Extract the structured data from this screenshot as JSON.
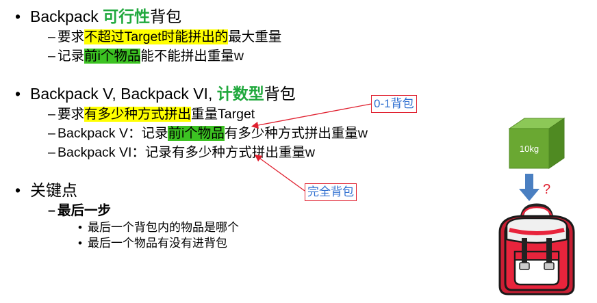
{
  "sections": [
    {
      "heading": {
        "bullet": "•",
        "pre": "Backpack ",
        "green": "可行性",
        "post": "背包"
      },
      "items": [
        {
          "dash": "–",
          "p1": "要求",
          "hl": "不超过Target时能拼出的",
          "p2": "最大重量"
        },
        {
          "dash": "–",
          "p1": "记录",
          "hl": "前i个物品",
          "p2": "能不能拼出重量w"
        }
      ]
    },
    {
      "heading": {
        "bullet": "•",
        "pre": "Backpack V, Backpack VI, ",
        "green": "计数型",
        "post": "背包"
      },
      "items": [
        {
          "dash": "–",
          "p1": "要求",
          "hl": "有多少种方式拼出",
          "p2": "重量Target"
        },
        {
          "dash": "–",
          "p1": "Backpack V：记录",
          "hl": "前i个物品",
          "p2": "有多少种方式拼出重量w"
        },
        {
          "dash": "–",
          "p1": "Backpack VI：记录有多少种方式拼出重量w"
        }
      ]
    },
    {
      "heading": {
        "bullet": "•",
        "text": "关键点"
      },
      "sub": {
        "dash": "–",
        "text": "最后一步"
      },
      "points": [
        {
          "bullet": "•",
          "text": "最后一个背包内的物品是哪个"
        },
        {
          "bullet": "•",
          "text": "最后一个物品有没有进背包"
        }
      ]
    }
  ],
  "callouts": {
    "zero_one": "0-1背包",
    "complete": "完全背包"
  },
  "illustration": {
    "box_label": "10kg",
    "question_mark": "?"
  },
  "colors": {
    "highlight_yellow": "#ffff00",
    "highlight_green": "#3cc222",
    "keyword_green": "#1fa83c",
    "callout_border": "#e0202f",
    "callout_text": "#2f6fd0",
    "box_green": "#6aa832",
    "arrow_blue": "#4a7fc1",
    "backpack_red": "#e8243c"
  }
}
